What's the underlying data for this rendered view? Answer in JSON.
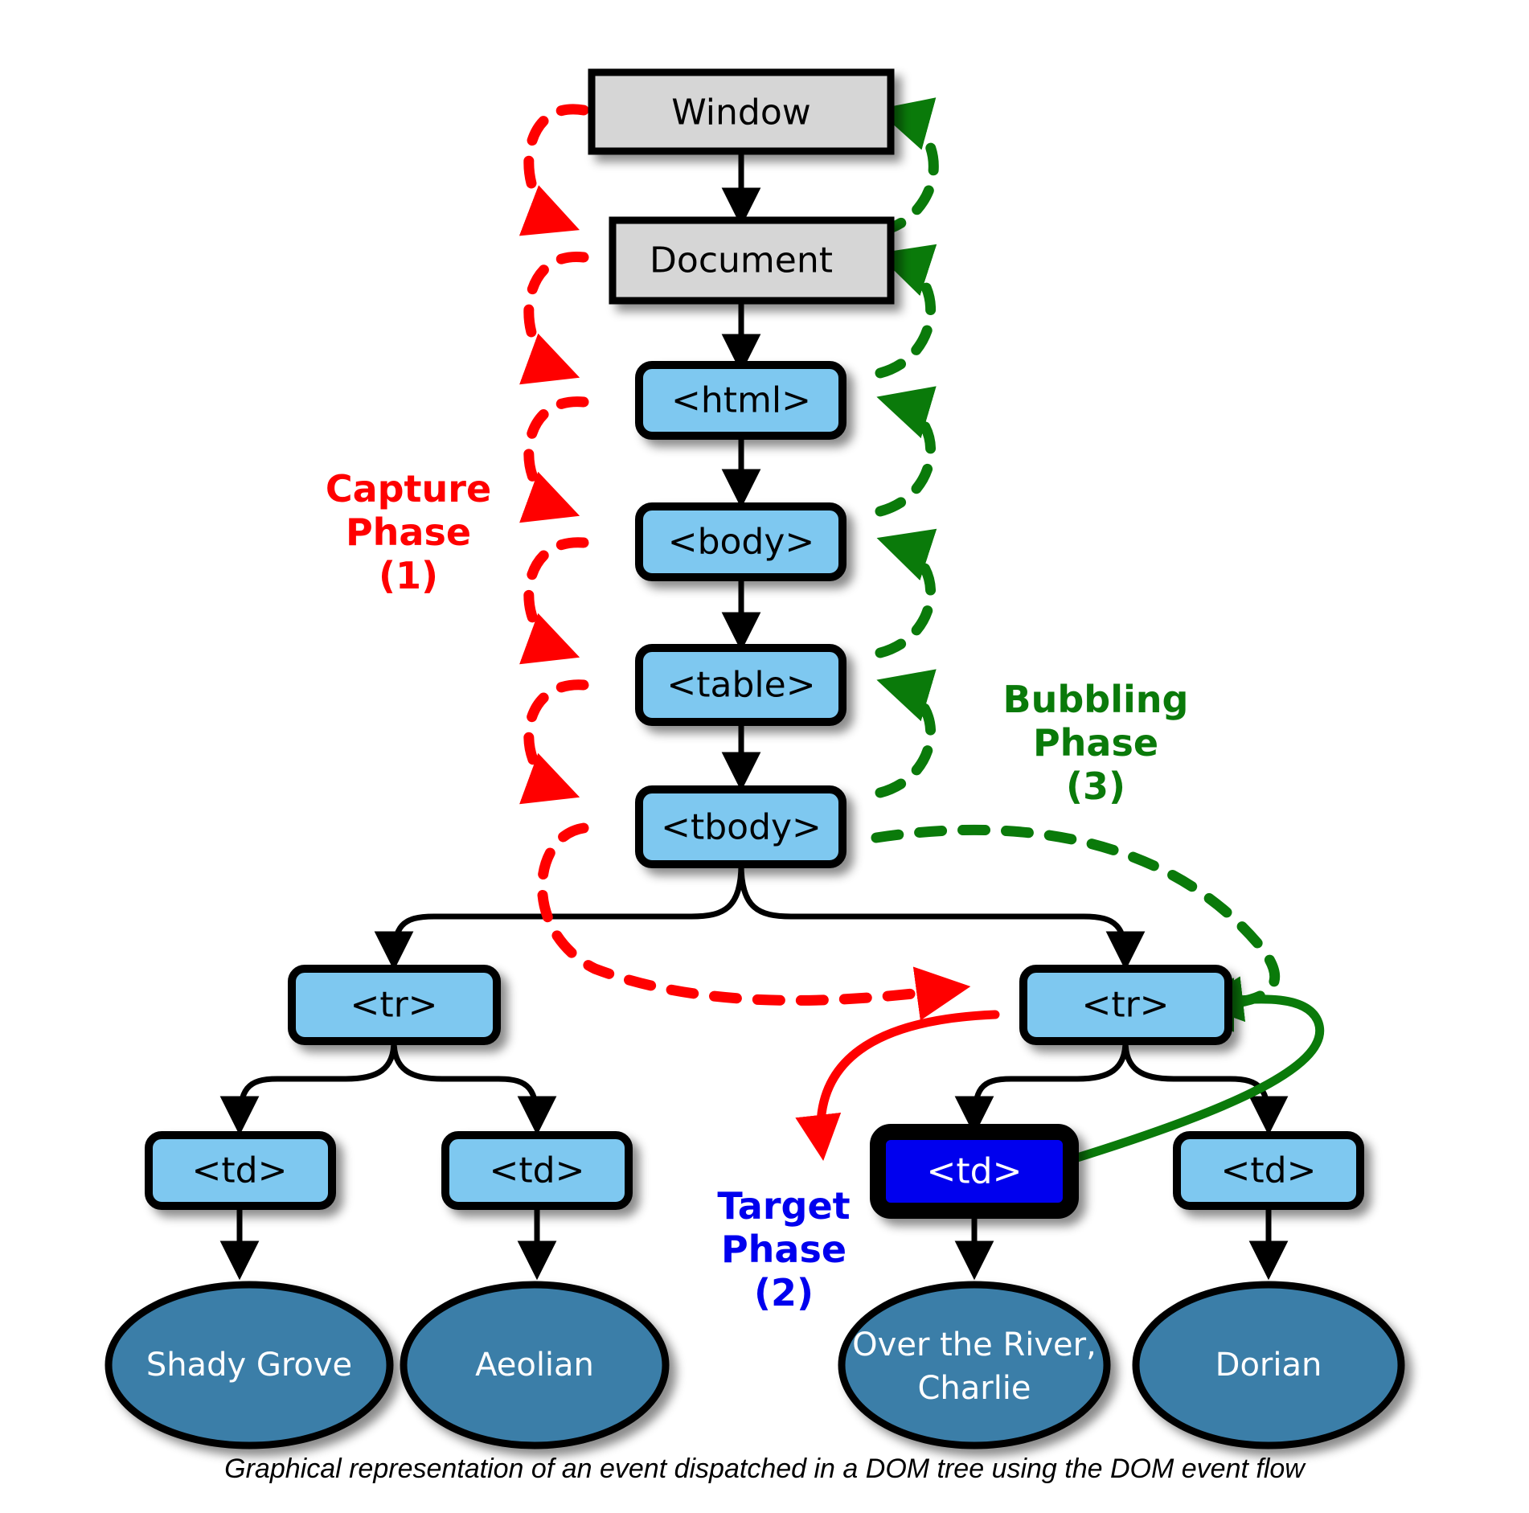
{
  "diagram": {
    "title": "DOM event flow",
    "caption": "Graphical representation of an event dispatched in a DOM tree using the DOM event flow",
    "colors": {
      "capture": "#ff0000",
      "target": "#0000ee",
      "bubbling": "#0a7a0a",
      "element_box_fill": "#7ec8f0",
      "host_box_fill": "#d6d6d6",
      "target_box_fill": "#0000ee",
      "leaf_fill": "#3b7ea8",
      "stroke": "#000000",
      "background": "#ffffff"
    },
    "nodes": {
      "window": "Window",
      "document": "Document",
      "html": "<html>",
      "body": "<body>",
      "table": "<table>",
      "tbody": "<tbody>",
      "tr_left": "<tr>",
      "tr_right": "<tr>",
      "td_left_1": "<td>",
      "td_left_2": "<td>",
      "td_target": "<td>",
      "td_right_2": "<td>",
      "text_shady_grove": "Shady Grove",
      "text_aeolian": "Aeolian",
      "text_over_the_river_line1": "Over the River,",
      "text_over_the_river_line2": "Charlie",
      "text_dorian": "Dorian"
    },
    "phases": {
      "capture": {
        "line1": "Capture",
        "line2": "Phase",
        "line3": "(1)"
      },
      "target": {
        "line1": "Target",
        "line2": "Phase",
        "line3": "(2)"
      },
      "bubbling": {
        "line1": "Bubbling",
        "line2": "Phase",
        "line3": "(3)"
      }
    }
  }
}
